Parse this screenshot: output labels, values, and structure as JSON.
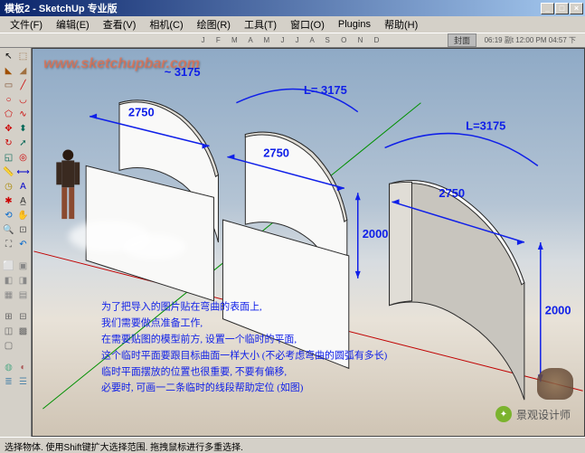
{
  "titlebar": {
    "text": "模板2 - SketchUp 专业版",
    "min": "_",
    "max": "□",
    "close": "×"
  },
  "menu": {
    "file": "文件(F)",
    "edit": "编辑(E)",
    "view": "查看(V)",
    "camera": "相机(C)",
    "draw": "绘图(R)",
    "tools": "工具(T)",
    "window": "窗口(O)",
    "plugins": "Plugins",
    "help": "帮助(H)"
  },
  "topbar": {
    "months": "J F M A M J J A S O N D",
    "label": "封面",
    "times": "06:19 副t  12:00 PM  04:57 下"
  },
  "watermark": "www.sketchupbar.com",
  "dims": {
    "top1": "~ 3175",
    "L1": "L= 3175",
    "L2": "L=3175",
    "w1": "2750",
    "w2": "2750",
    "w3": "2750",
    "h1": "2000",
    "h2": "2000"
  },
  "desc": {
    "l1": "为了把导入的图片贴在弯曲的表面上,",
    "l2": "我们需要做点准备工作,",
    "l3": "在需要贴图的模型前方, 设置一个临时的平面,",
    "l4": "这个临时平面要跟目标曲面一样大小 (不必考虑弯曲的圆弧有多长)",
    "l5": "临时平面摆放的位置也很重要, 不要有偏移,",
    "l6": "必要时, 可画一二条临时的线段帮助定位 (如图)"
  },
  "status": "选择物体. 使用Shift键扩大选择范围. 拖拽鼠标进行多重选择.",
  "wechat": "景观设计师",
  "icons": {
    "select": "▲",
    "eraser": "◢",
    "rect": "▭",
    "line": "╱",
    "pencil": "✎",
    "circle": "○",
    "arc": "◗",
    "poly": "⬠",
    "push": "⬍",
    "move": "✥",
    "rot": "↻",
    "scale": "◱",
    "offset": "◎",
    "tape": "📏",
    "dim": "⟷",
    "text": "A",
    "paint": "🪣",
    "orbit": "⟲",
    "pan": "✋",
    "zoom": "🔍",
    "extent": "⛶"
  }
}
